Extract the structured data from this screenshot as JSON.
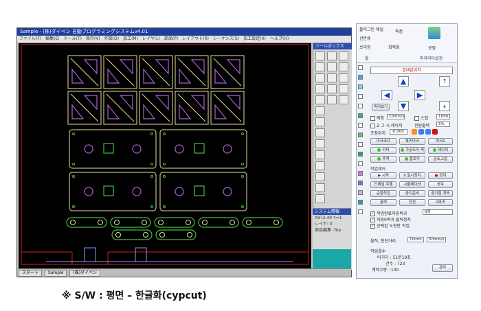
{
  "cad": {
    "title": "Sample - (株)ダイベン  自動プログラミングシステムv4.01",
    "menu": [
      "ファイル(F)",
      "編集(E)",
      "ツール(T)",
      "表示(V)",
      "作図(D)",
      "加工(M)",
      "レイヤ(L)",
      "部品(P)",
      "レイアウト(R)",
      "シーケンス(S)",
      "加工設定(X)",
      "ヘルプ(H)"
    ],
    "toolbox_title": "ツールボックス",
    "sysinfo_title": "システム情報",
    "sysinfo": [
      "X972.40   Y=1",
      "レイヤ:  0",
      "部品編集 -Top"
    ],
    "taskbar": [
      "スタート",
      "Sample",
      "(株)ダイベン"
    ]
  },
  "panel": {
    "ribbon": {
      "btn1": "플러그인 제일",
      "btn2": "측정",
      "btn3": "선분류",
      "btn4": "브리징",
      "btn5": "최적화",
      "btn6": "공정",
      "group1": "툴",
      "group2": "파라미터설정"
    },
    "mode_select": "절대값위치",
    "arrows": {
      "up": "▲",
      "down": "▼",
      "left": "◀",
      "right": "▶"
    },
    "btn_mirror": "미러보기",
    "opt_speed_label": "에칭",
    "opt_speed_val": "10mm/s",
    "opt_step_label": "스텝",
    "opt_step_val": "1mm",
    "opt_z_label": "Z 그 시 레이저",
    "opt_power_label": "전원출력",
    "opt_power_val": "5%",
    "coord_label": "조정위치",
    "coord_val": "-0.000",
    "buttons": {
      "mark_cur": "마크코프",
      "mark_back": "복귀마크",
      "mark_1": "마크1",
      "cut": "커터",
      "goto_origin": "가공도타 즉",
      "laser": "레이저",
      "home": "추적",
      "blower": "블로우",
      "auto_align": "공조고압"
    },
    "section_job": "작업제어",
    "job": {
      "start": "시작",
      "pause": "일시정지",
      "stop": "정지",
      "sim": "드레임 주행",
      "simulation": "시뮬레이션",
      "air": "공주",
      "frame": "순환작업",
      "set": "출도",
      "overlap": "중지준비",
      "cross": "중지점 계속",
      "speed": "출력",
      "prev": "전진",
      "return": "0복귀"
    },
    "checks": [
      {
        "label": "작업완료자동복귀",
        "checked": true
      },
      {
        "label": "자동0복귀 클릭정지",
        "checked": true
      },
      {
        "label": "선택된 도형만 작업",
        "checked": true
      }
    ],
    "return_select": "0점",
    "move_label": "움직, 천진거리:",
    "move_dist": "10mm",
    "move_speed": "50mm/s",
    "job_count_title": "작업결수",
    "time_label": "타기다 : 51분19초",
    "count_label": "건수 : 723",
    "total_label": "계작수량 : 100",
    "manage_button": "관리"
  },
  "caption": "※ S/W : 평면 – 한글화(cypcut)",
  "colors": {
    "canvas_bg": "#000000",
    "part_outline": "#e8e0a0",
    "part_hole": "#b060d0",
    "part_green": "#40c040",
    "sheet_edge": "#d02020",
    "blue_frame": "#6080ff",
    "teal": "#1aa7a7"
  }
}
